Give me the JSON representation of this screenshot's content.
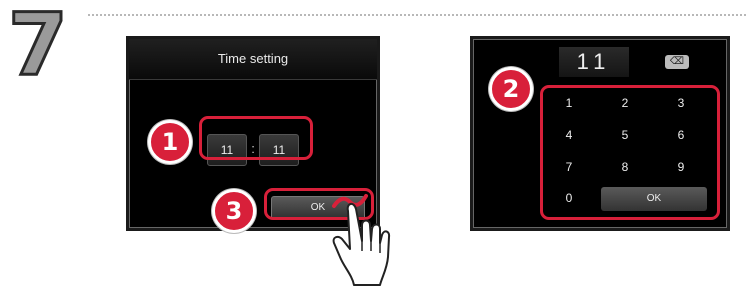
{
  "step": {
    "number": "7"
  },
  "screen1": {
    "title": "Time setting",
    "hours": "11",
    "separator": ":",
    "minutes": "11",
    "ok_label": "OK"
  },
  "screen2": {
    "display_value": "11",
    "backspace_label": "⌫",
    "keys": [
      "1",
      "2",
      "3",
      "4",
      "5",
      "6",
      "7",
      "8",
      "9",
      "0"
    ],
    "ok_label": "OK"
  },
  "callouts": {
    "badge1": "1",
    "badge2": "2",
    "badge3": "3"
  },
  "colors": {
    "accent": "#d8203a",
    "screen_bg": "#000000",
    "step_gray": "#9a9a9a"
  }
}
